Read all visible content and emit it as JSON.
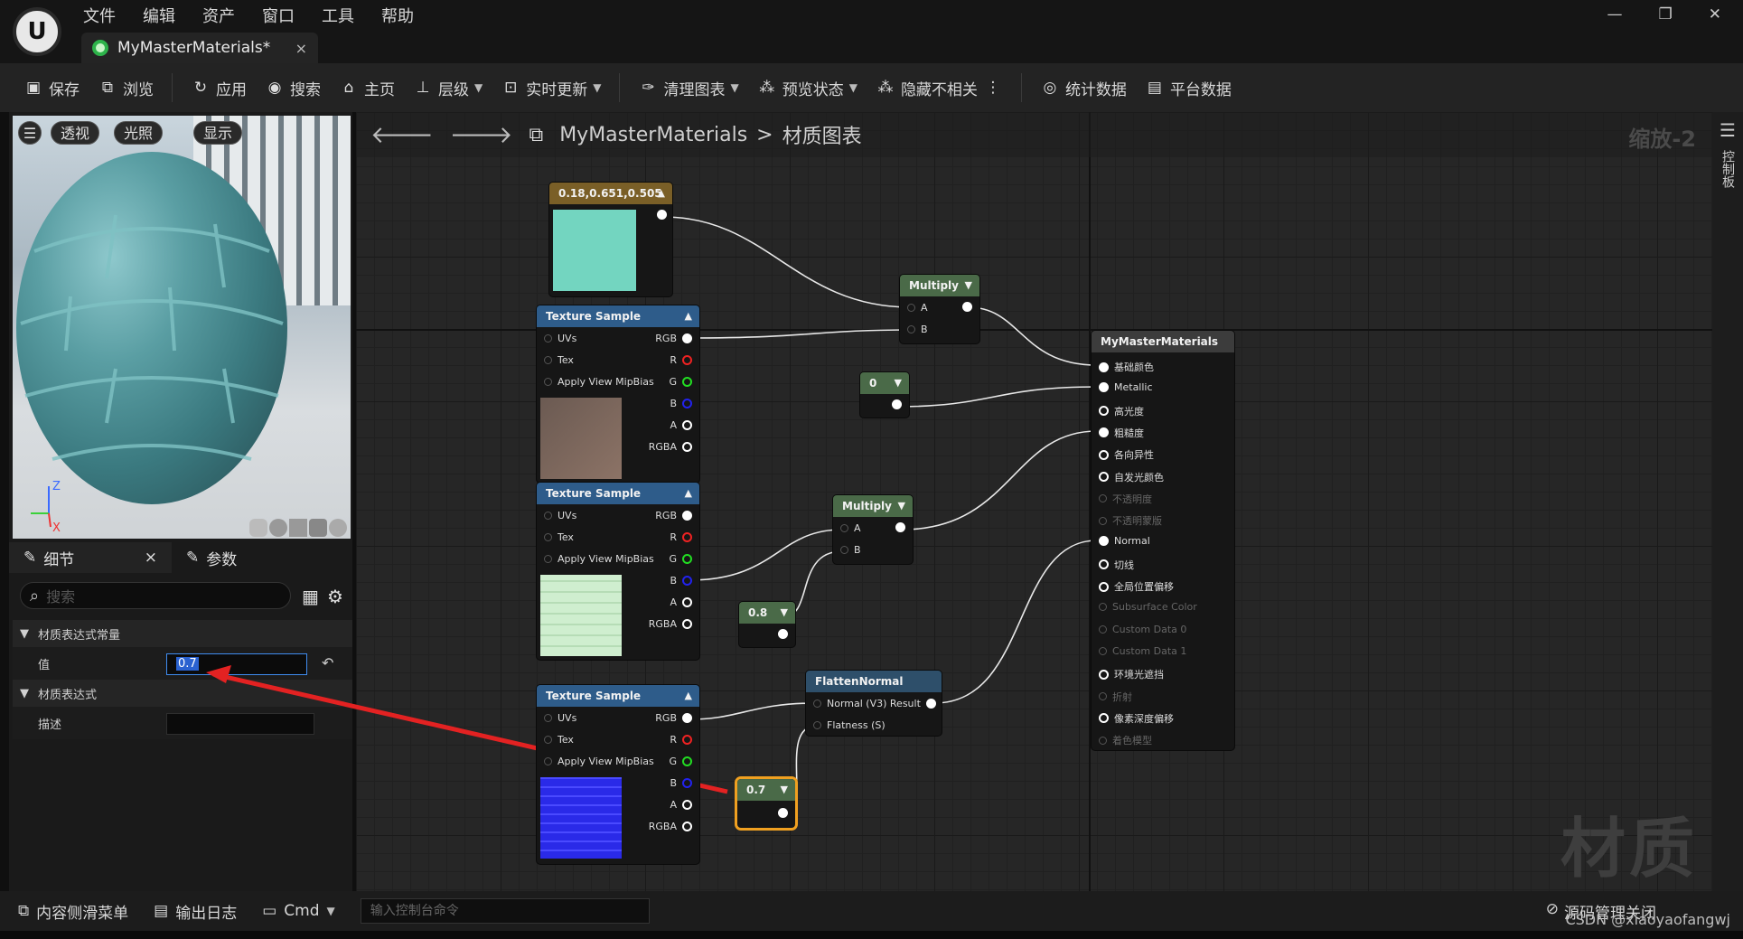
{
  "menu": [
    "文件",
    "编辑",
    "资产",
    "窗口",
    "工具",
    "帮助"
  ],
  "tab": {
    "title": "MyMasterMaterials*",
    "close": "×"
  },
  "window_controls": [
    "—",
    "❐",
    "✕"
  ],
  "toolbar": {
    "save": "保存",
    "browse": "浏览",
    "apply": "应用",
    "search": "搜索",
    "home": "主页",
    "hierarchy": "层级",
    "live_update": "实时更新",
    "clean_graph": "清理图表",
    "preview_state": "预览状态",
    "hide_unrelated": "隐藏不相关",
    "stats": "统计数据",
    "platform_stats": "平台数据"
  },
  "viewport": {
    "perspective": "透视",
    "lighting": "光照",
    "show": "显示"
  },
  "details": {
    "tab_details": "细节",
    "tab_close": "×",
    "tab_params": "参数",
    "search_placeholder": "搜索",
    "section1": "材质表达式常量",
    "value_label": "值",
    "value": "0.7",
    "section2": "材质表达式",
    "desc_label": "描述"
  },
  "graph": {
    "crumb_root": "MyMasterMaterials",
    "crumb_sep": ">",
    "crumb_leaf": "材质图表",
    "zoom": "缩放-2",
    "rail_label": "控制板",
    "watermark": "材质"
  },
  "nodes": {
    "color_const": {
      "title": "0.18,0.651,0.505",
      "swatch": "#73d5c0"
    },
    "tex1": {
      "title": "Texture Sample"
    },
    "tex2": {
      "title": "Texture Sample"
    },
    "tex3": {
      "title": "Texture Sample"
    },
    "tex_pins_in": [
      "UVs",
      "Tex",
      "Apply View MipBias"
    ],
    "tex_pins_out": [
      "RGB",
      "R",
      "G",
      "B",
      "A",
      "RGBA"
    ],
    "multiply1": {
      "title": "Multiply",
      "a": "A",
      "b": "B"
    },
    "multiply2": {
      "title": "Multiply",
      "a": "A",
      "b": "B"
    },
    "const0": {
      "title": "0"
    },
    "const08": {
      "title": "0.8"
    },
    "const07": {
      "title": "0.7"
    },
    "flatten": {
      "title": "FlattenNormal",
      "out": "Normal (V3) Result",
      "in": "Flatness (S)"
    },
    "master": {
      "title": "MyMasterMaterials",
      "pins": [
        "基础颜色",
        "Metallic",
        "高光度",
        "粗糙度",
        "各向异性",
        "自发光颜色",
        "不透明度",
        "不透明蒙版",
        "Normal",
        "切线",
        "全局位置偏移",
        "Subsurface Color",
        "Custom Data 0",
        "Custom Data 1",
        "环境光遮挡",
        "折射",
        "像素深度偏移",
        "着色模型"
      ]
    }
  },
  "statusbar": {
    "content_drawer": "内容侧滑菜单",
    "output_log": "输出日志",
    "cmd": "Cmd",
    "console_placeholder": "输入控制台命令",
    "source_control": "源码管理关闭"
  },
  "credit": "CSDN @xiaoyaofangwj",
  "colors": {
    "accent_input": "#3f8cf0",
    "arrow": "#e32222",
    "const_header": "#8a6a2a",
    "tex_header": "#2e5c8a",
    "math_header": "#4a6a48",
    "master_header": "#3a3a3a"
  }
}
